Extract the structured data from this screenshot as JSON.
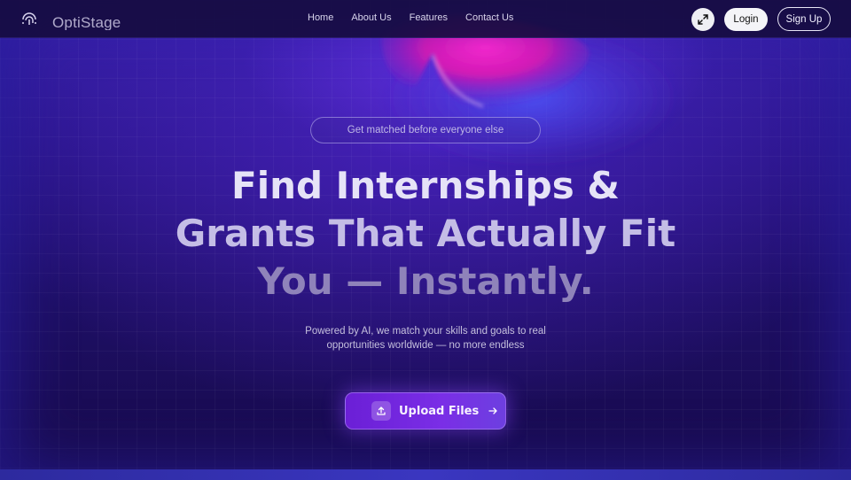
{
  "brand": {
    "name": "OptiStage",
    "logo_icon": "fingerprint-icon"
  },
  "nav": {
    "links": [
      "Home",
      "About Us",
      "Features",
      "Contact Us"
    ],
    "expand_icon": "expand-arrows-icon",
    "login_label": "Login",
    "signup_label": "Sign Up"
  },
  "hero": {
    "badge": "Get matched before everyone else",
    "headline": {
      "line1": "Find Internships &",
      "line2": "Grants That Actually Fit",
      "line3": "You — Instantly."
    },
    "subtitle_line1": "Powered by AI, we match your skills and goals to real",
    "subtitle_line2": "opportunities worldwide — no more endless",
    "cta_label": "Upload Files",
    "cta_icon": "upload-icon",
    "cta_arrow_icon": "arrow-right-icon"
  },
  "colors": {
    "background": "#1b0e4a",
    "accent_purple": "#7a2ee6",
    "accent_pink": "#e81cb8"
  }
}
